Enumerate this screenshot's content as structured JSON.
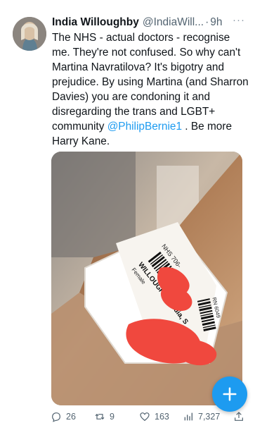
{
  "tweet": {
    "author_name": "India Willoughby",
    "author_handle": "@IndiaWill...",
    "separator": "·",
    "timestamp": "9h",
    "more_label": "···",
    "text_before_mention": "The NHS - actual doctors - recognise me. They're not confused. So why can't Martina Navratilova? It's bigotry and prejudice. By using Martina (and Sharron Davies) you are condoning it and disregarding the trans and LGBT+ community ",
    "mention": "@PhilipBernie1",
    "text_after_mention": " . Be more Harry Kane.",
    "image": {
      "wristband_lines": [
        "NHS 706-",
        "WILLOUGHBY, India, S",
        "Female",
        "RN 6049"
      ],
      "label_colors": {
        "redaction": "#f0483e",
        "band": "#ffffff",
        "skin": "#a7764f"
      }
    },
    "actions": {
      "reply_count": "26",
      "retweet_count": "9",
      "like_count": "163",
      "views_count": "7,327"
    }
  },
  "fab_label": "+",
  "colors": {
    "accent": "#1d9bf0",
    "text": "#0f1419",
    "muted": "#536471"
  }
}
